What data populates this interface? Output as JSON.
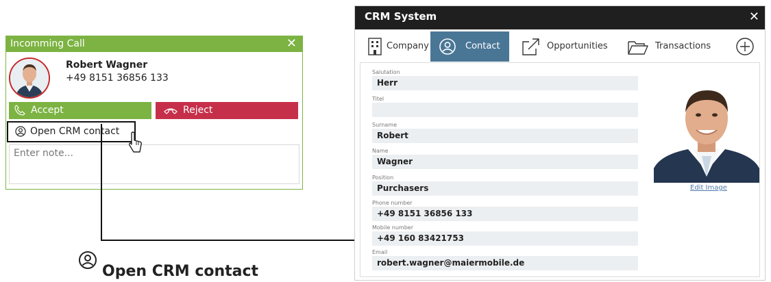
{
  "incoming_call": {
    "title": "Incomming Call",
    "close_glyph": "✕",
    "caller_name": "Robert Wagner",
    "caller_phone": "+49 8151 36856 133",
    "accept_label": "Accept",
    "reject_label": "Reject",
    "open_crm_label": "Open CRM contact",
    "note_placeholder": "Enter note...",
    "colors": {
      "accent": "#7cb342",
      "reject": "#c62f4a"
    }
  },
  "callout": {
    "label": "Open CRM contact",
    "icon": "contact-icon"
  },
  "crm": {
    "title": "CRM System",
    "close_glyph": "✕",
    "tabs": [
      {
        "label": "Company",
        "icon": "building-icon"
      },
      {
        "label": "Contact",
        "icon": "contact-icon",
        "selected": true
      },
      {
        "label": "Opportunities",
        "icon": "external-link-icon"
      },
      {
        "label": "Transactions",
        "icon": "folder-icon"
      }
    ],
    "add_icon": "plus-circle-icon",
    "fields": [
      {
        "label": "Salutation",
        "value": "Herr"
      },
      {
        "label": "Titel",
        "value": ""
      },
      {
        "label": "Surname",
        "value": "Robert"
      },
      {
        "label": "Name",
        "value": "Wagner"
      },
      {
        "label": "Position",
        "value": "Purchasers"
      },
      {
        "label": "Phone number",
        "value": "+49 8151 36856 133"
      },
      {
        "label": "Mobile number",
        "value": "+49 160 83421753"
      },
      {
        "label": "Email",
        "value": "robert.wagner@maiermobile.de"
      }
    ],
    "edit_image_label": "Edit Image",
    "colors": {
      "title_bar": "#1f1f1f",
      "active_tab": "#4a7696",
      "field_bg": "#eceff2",
      "link": "#4f79a8"
    }
  }
}
